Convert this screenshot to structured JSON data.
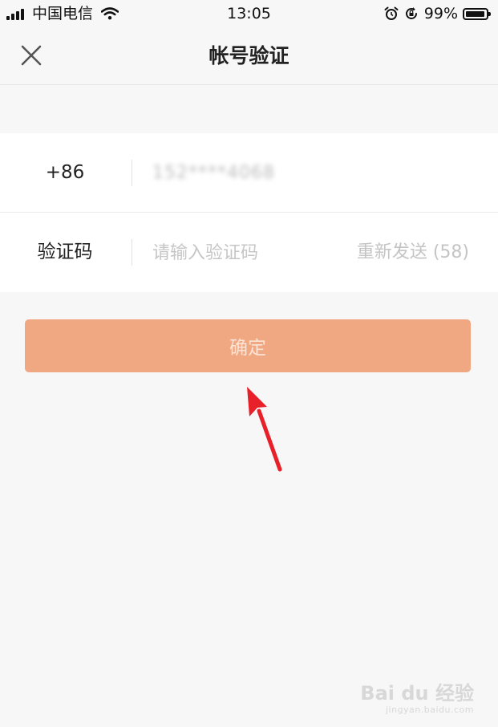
{
  "status_bar": {
    "carrier": "中国电信",
    "time": "13:05",
    "battery": "99%"
  },
  "nav": {
    "title": "帐号验证"
  },
  "form": {
    "country_code": "+86",
    "phone_number": "152****4068",
    "code_label": "验证码",
    "code_placeholder": "请输入验证码",
    "resend_label": "重新发送 (58)"
  },
  "actions": {
    "confirm_label": "确定"
  },
  "watermark": {
    "main": "Bai du 经验",
    "sub": "jingyan.baidu.com"
  },
  "colors": {
    "background": "#f7f7f7",
    "confirm_button": "#f0a882",
    "annotation_arrow": "#e8202a"
  }
}
